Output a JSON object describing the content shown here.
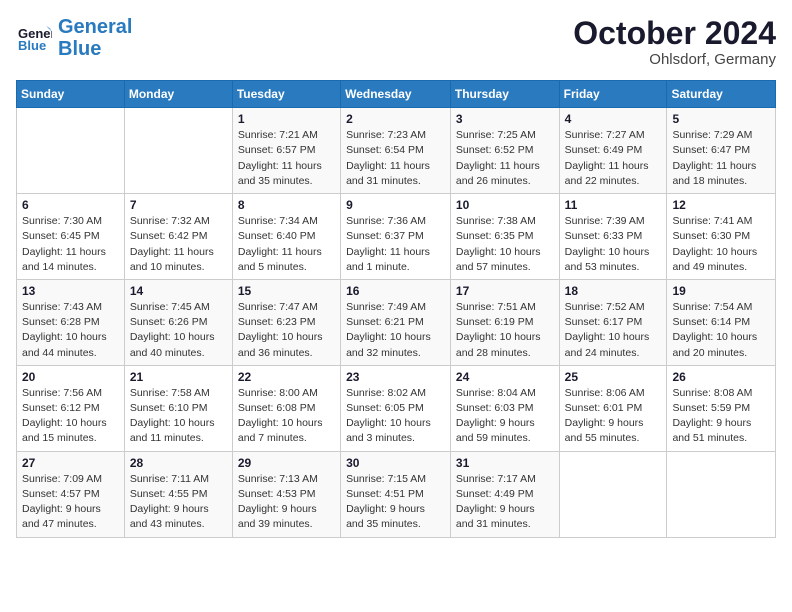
{
  "header": {
    "logo_line1": "General",
    "logo_line2": "Blue",
    "month": "October 2024",
    "location": "Ohlsdorf, Germany"
  },
  "weekdays": [
    "Sunday",
    "Monday",
    "Tuesday",
    "Wednesday",
    "Thursday",
    "Friday",
    "Saturday"
  ],
  "weeks": [
    [
      {
        "day": "",
        "info": ""
      },
      {
        "day": "",
        "info": ""
      },
      {
        "day": "1",
        "info": "Sunrise: 7:21 AM\nSunset: 6:57 PM\nDaylight: 11 hours\nand 35 minutes."
      },
      {
        "day": "2",
        "info": "Sunrise: 7:23 AM\nSunset: 6:54 PM\nDaylight: 11 hours\nand 31 minutes."
      },
      {
        "day": "3",
        "info": "Sunrise: 7:25 AM\nSunset: 6:52 PM\nDaylight: 11 hours\nand 26 minutes."
      },
      {
        "day": "4",
        "info": "Sunrise: 7:27 AM\nSunset: 6:49 PM\nDaylight: 11 hours\nand 22 minutes."
      },
      {
        "day": "5",
        "info": "Sunrise: 7:29 AM\nSunset: 6:47 PM\nDaylight: 11 hours\nand 18 minutes."
      }
    ],
    [
      {
        "day": "6",
        "info": "Sunrise: 7:30 AM\nSunset: 6:45 PM\nDaylight: 11 hours\nand 14 minutes."
      },
      {
        "day": "7",
        "info": "Sunrise: 7:32 AM\nSunset: 6:42 PM\nDaylight: 11 hours\nand 10 minutes."
      },
      {
        "day": "8",
        "info": "Sunrise: 7:34 AM\nSunset: 6:40 PM\nDaylight: 11 hours\nand 5 minutes."
      },
      {
        "day": "9",
        "info": "Sunrise: 7:36 AM\nSunset: 6:37 PM\nDaylight: 11 hours\nand 1 minute."
      },
      {
        "day": "10",
        "info": "Sunrise: 7:38 AM\nSunset: 6:35 PM\nDaylight: 10 hours\nand 57 minutes."
      },
      {
        "day": "11",
        "info": "Sunrise: 7:39 AM\nSunset: 6:33 PM\nDaylight: 10 hours\nand 53 minutes."
      },
      {
        "day": "12",
        "info": "Sunrise: 7:41 AM\nSunset: 6:30 PM\nDaylight: 10 hours\nand 49 minutes."
      }
    ],
    [
      {
        "day": "13",
        "info": "Sunrise: 7:43 AM\nSunset: 6:28 PM\nDaylight: 10 hours\nand 44 minutes."
      },
      {
        "day": "14",
        "info": "Sunrise: 7:45 AM\nSunset: 6:26 PM\nDaylight: 10 hours\nand 40 minutes."
      },
      {
        "day": "15",
        "info": "Sunrise: 7:47 AM\nSunset: 6:23 PM\nDaylight: 10 hours\nand 36 minutes."
      },
      {
        "day": "16",
        "info": "Sunrise: 7:49 AM\nSunset: 6:21 PM\nDaylight: 10 hours\nand 32 minutes."
      },
      {
        "day": "17",
        "info": "Sunrise: 7:51 AM\nSunset: 6:19 PM\nDaylight: 10 hours\nand 28 minutes."
      },
      {
        "day": "18",
        "info": "Sunrise: 7:52 AM\nSunset: 6:17 PM\nDaylight: 10 hours\nand 24 minutes."
      },
      {
        "day": "19",
        "info": "Sunrise: 7:54 AM\nSunset: 6:14 PM\nDaylight: 10 hours\nand 20 minutes."
      }
    ],
    [
      {
        "day": "20",
        "info": "Sunrise: 7:56 AM\nSunset: 6:12 PM\nDaylight: 10 hours\nand 15 minutes."
      },
      {
        "day": "21",
        "info": "Sunrise: 7:58 AM\nSunset: 6:10 PM\nDaylight: 10 hours\nand 11 minutes."
      },
      {
        "day": "22",
        "info": "Sunrise: 8:00 AM\nSunset: 6:08 PM\nDaylight: 10 hours\nand 7 minutes."
      },
      {
        "day": "23",
        "info": "Sunrise: 8:02 AM\nSunset: 6:05 PM\nDaylight: 10 hours\nand 3 minutes."
      },
      {
        "day": "24",
        "info": "Sunrise: 8:04 AM\nSunset: 6:03 PM\nDaylight: 9 hours\nand 59 minutes."
      },
      {
        "day": "25",
        "info": "Sunrise: 8:06 AM\nSunset: 6:01 PM\nDaylight: 9 hours\nand 55 minutes."
      },
      {
        "day": "26",
        "info": "Sunrise: 8:08 AM\nSunset: 5:59 PM\nDaylight: 9 hours\nand 51 minutes."
      }
    ],
    [
      {
        "day": "27",
        "info": "Sunrise: 7:09 AM\nSunset: 4:57 PM\nDaylight: 9 hours\nand 47 minutes."
      },
      {
        "day": "28",
        "info": "Sunrise: 7:11 AM\nSunset: 4:55 PM\nDaylight: 9 hours\nand 43 minutes."
      },
      {
        "day": "29",
        "info": "Sunrise: 7:13 AM\nSunset: 4:53 PM\nDaylight: 9 hours\nand 39 minutes."
      },
      {
        "day": "30",
        "info": "Sunrise: 7:15 AM\nSunset: 4:51 PM\nDaylight: 9 hours\nand 35 minutes."
      },
      {
        "day": "31",
        "info": "Sunrise: 7:17 AM\nSunset: 4:49 PM\nDaylight: 9 hours\nand 31 minutes."
      },
      {
        "day": "",
        "info": ""
      },
      {
        "day": "",
        "info": ""
      }
    ]
  ]
}
